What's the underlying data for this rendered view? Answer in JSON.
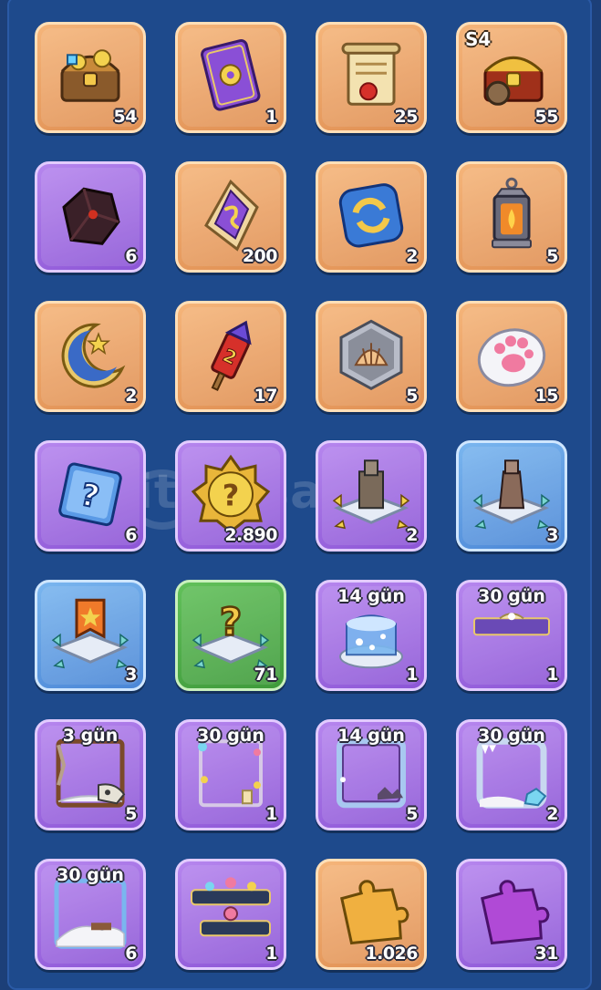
{
  "colors": {
    "background": "#1e4a8c",
    "tile_orange": "#e9a064",
    "tile_purple": "#a06ee3",
    "tile_blue": "#5f9ee2",
    "tile_green": "#4fae48"
  },
  "watermark": {
    "text": "itemsatis"
  },
  "items": [
    {
      "icon": "treasure-chest-icon",
      "tile": "orange",
      "count": "54"
    },
    {
      "icon": "purple-card-icon",
      "tile": "orange",
      "count": "1"
    },
    {
      "icon": "scroll-icon",
      "tile": "orange",
      "count": "25"
    },
    {
      "icon": "season-chest-icon",
      "tile": "orange",
      "count": "55",
      "season": "S4"
    },
    {
      "icon": "dark-ore-icon",
      "tile": "purple",
      "count": "6"
    },
    {
      "icon": "purple-gem-icon",
      "tile": "orange",
      "count": "200"
    },
    {
      "icon": "swap-token-icon",
      "tile": "orange",
      "count": "2"
    },
    {
      "icon": "lantern-icon",
      "tile": "orange",
      "count": "5"
    },
    {
      "icon": "crescent-moon-icon",
      "tile": "orange",
      "count": "2"
    },
    {
      "icon": "firework-rocket-icon",
      "tile": "orange",
      "count": "17"
    },
    {
      "icon": "shell-coin-icon",
      "tile": "orange",
      "count": "5"
    },
    {
      "icon": "paw-token-icon",
      "tile": "orange",
      "count": "15"
    },
    {
      "icon": "mystery-card-icon",
      "tile": "purple",
      "count": "6"
    },
    {
      "icon": "mystery-badge-icon",
      "tile": "purple",
      "count": "2.890"
    },
    {
      "icon": "castle-platform-icon",
      "tile": "purple",
      "count": "2"
    },
    {
      "icon": "tower-platform-icon",
      "tile": "blue",
      "count": "3"
    },
    {
      "icon": "banner-platform-icon",
      "tile": "blue",
      "count": "3"
    },
    {
      "icon": "question-platform-icon",
      "tile": "green",
      "count": "71"
    },
    {
      "icon": "snow-globe-icon",
      "tile": "purple",
      "count": "1",
      "duration": "14 gün"
    },
    {
      "icon": "nameplate-icon",
      "tile": "purple",
      "count": "1",
      "duration": "30 gün"
    },
    {
      "icon": "skull-frame-icon",
      "tile": "purple",
      "count": "5",
      "duration": "3 gün"
    },
    {
      "icon": "festive-frame-icon",
      "tile": "purple",
      "count": "1",
      "duration": "30 gün"
    },
    {
      "icon": "winter-frame-icon",
      "tile": "purple",
      "count": "5",
      "duration": "14 gün"
    },
    {
      "icon": "ice-frame-icon",
      "tile": "purple",
      "count": "2",
      "duration": "30 gün"
    },
    {
      "icon": "snow-frame-icon",
      "tile": "purple",
      "count": "6",
      "duration": "30 gün"
    },
    {
      "icon": "chat-bubble-icon",
      "tile": "purple",
      "count": "1"
    },
    {
      "icon": "gold-puzzle-icon",
      "tile": "orange",
      "count": "1.026"
    },
    {
      "icon": "purple-puzzle-icon",
      "tile": "purple",
      "count": "31"
    }
  ]
}
